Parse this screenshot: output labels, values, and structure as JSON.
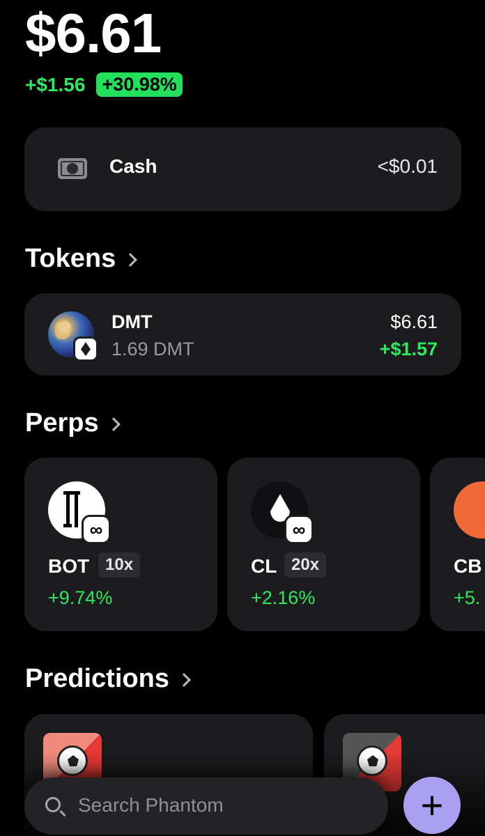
{
  "portfolio": {
    "balance": "$6.61",
    "change_abs": "+$1.56",
    "change_pct": "+30.98%"
  },
  "cash": {
    "label": "Cash",
    "value": "<$0.01",
    "icon": "cash-icon"
  },
  "sections": {
    "tokens": "Tokens",
    "perps": "Perps",
    "predictions": "Predictions"
  },
  "tokens": [
    {
      "name": "DMT",
      "quantity": "1.69 DMT",
      "value": "$6.61",
      "change": "+$1.57",
      "chain_icon": "ethereum-icon"
    }
  ],
  "perps": [
    {
      "symbol": "BOT",
      "leverage": "10x",
      "change": "+9.74%",
      "icon": "bot-icon"
    },
    {
      "symbol": "CL",
      "leverage": "20x",
      "change": "+2.16%",
      "icon": "oil-drop-icon"
    },
    {
      "symbol": "CB",
      "leverage": "",
      "change": "+5.",
      "icon": "cb-icon"
    }
  ],
  "perp_badge": "∞",
  "predictions": [
    {
      "icon": "soccer-ball-icon",
      "color": "#e53935"
    },
    {
      "icon": "soccer-ball-icon",
      "color": "#e53935"
    }
  ],
  "search": {
    "placeholder": "Search Phantom"
  },
  "fab": {
    "label": "+"
  },
  "colors": {
    "positive": "#2ee85f",
    "accent": "#ab9ff2",
    "card": "#1c1c1e"
  }
}
